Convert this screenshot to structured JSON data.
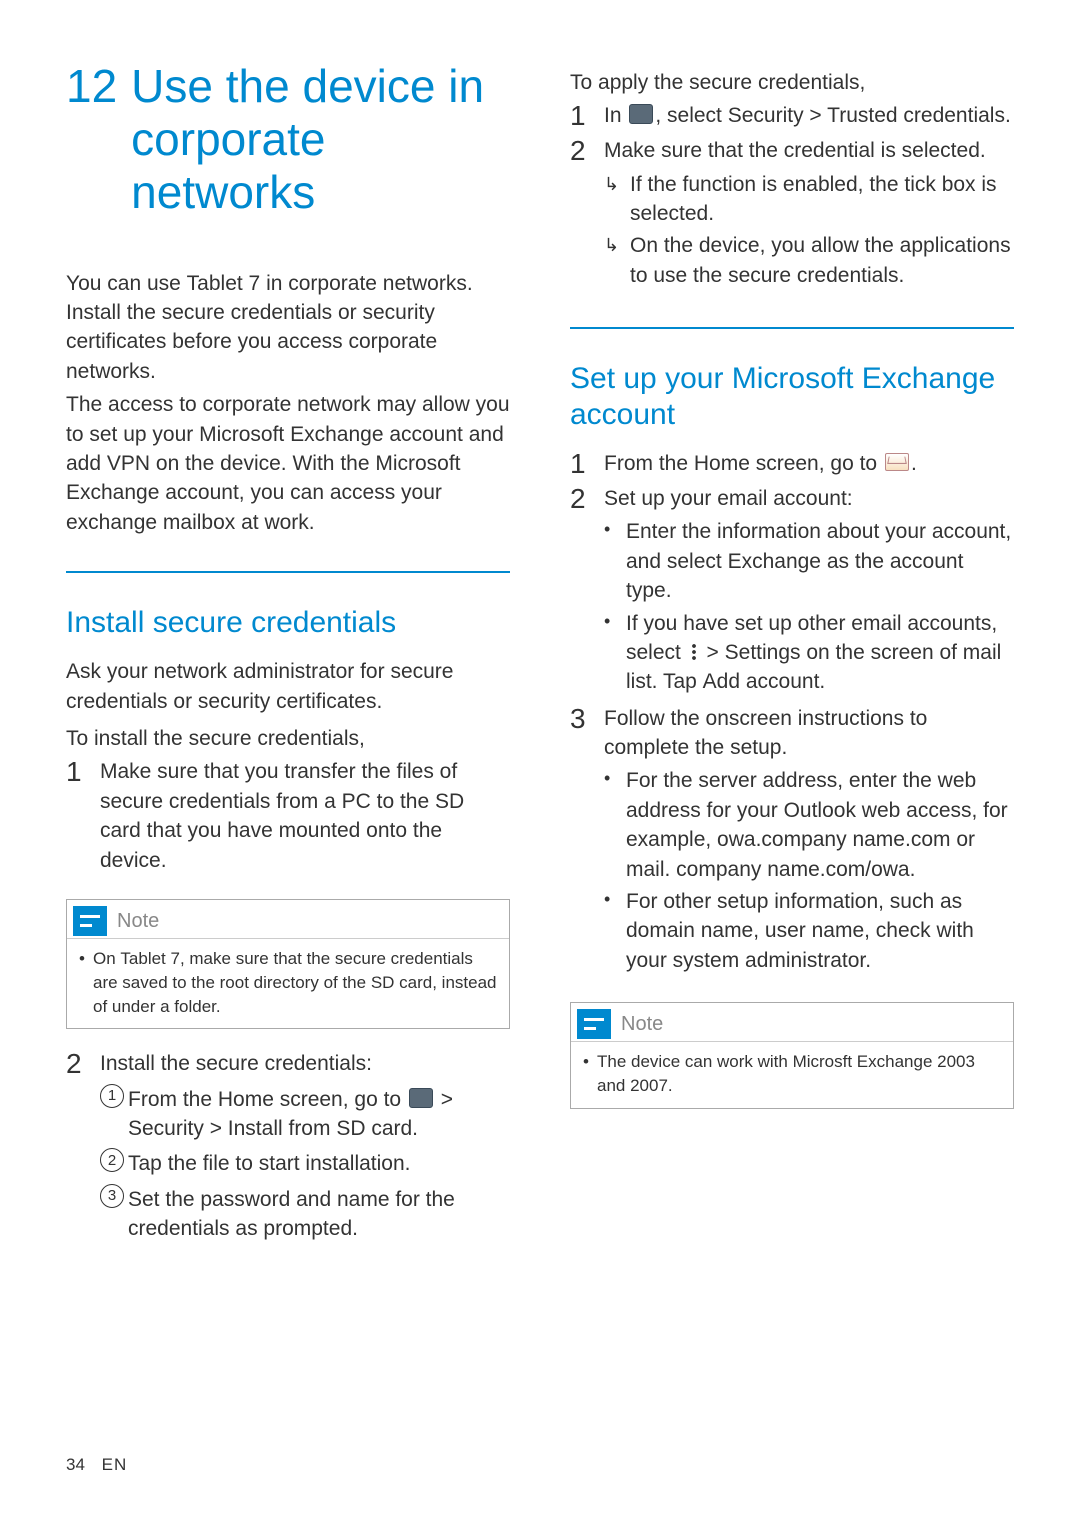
{
  "chapter": {
    "number": "12",
    "title": "Use the device in corporate networks"
  },
  "intro": {
    "p1a": "You can use ",
    "p1b": "Tablet 7",
    "p1c": " in corporate networks. Install the secure credentials or security certificates before you access corporate networks.",
    "p2": "The access to corporate network may allow you to set up your Microsoft Exchange account and add VPN on the device. With the Microsoft Exchange account, you can access your exchange mailbox at work."
  },
  "sectionA": {
    "title": "Install secure credentials",
    "lead": "Ask your network administrator for secure credentials or security certificates.",
    "sub1": "To install the secure credentials,",
    "step1": "Make sure that you transfer the files of secure credentials from a PC to the SD card that you have mounted onto the device.",
    "note_label": "Note",
    "note_a": "On ",
    "note_b": "Tablet 7",
    "note_c": ", make sure that the secure credentials are saved to the root directory of the SD card, instead of under a folder.",
    "step2_intro": "Install the secure credentials:",
    "sub_a1": "From the Home screen, go to ",
    "sub_a2": " > Security > Install from SD card.",
    "sub_b": "Tap the file to start installation.",
    "sub_c": "Set the password and name for the credentials as prompted."
  },
  "sectionB": {
    "sub1": "To apply the secure credentials,",
    "s1a": "In ",
    "s1b": ", select ",
    "s1c": "Security > Trusted credentials",
    "s1d": ".",
    "s2": "Make sure that the credential is selected.",
    "s2_r1": "If the function is enabled, the tick box is selected.",
    "s2_r2": "On the device, you allow the applications to use the secure credentials."
  },
  "sectionC": {
    "title": "Set up your Microsoft Exchange account",
    "s1a": "From the Home screen, go to ",
    "s1b": ".",
    "s2": "Set up your email account:",
    "s2_b1a": "Enter the information about your account, and select ",
    "s2_b1b": "Exchange",
    "s2_b1c": " as the account type.",
    "s2_b2a": "If you have set up other email accounts, select ",
    "s2_b2b": " > ",
    "s2_b2c": "Settings",
    "s2_b2d": " on the screen of mail list. Tap ",
    "s2_b2e": "Add account",
    "s2_b2f": ".",
    "s3": "Follow the onscreen instructions to complete the setup.",
    "s3_b1": "For the server address, enter the web address for your Outlook web access, for example, owa.company name.com or mail. company name.com/owa.",
    "s3_b2": "For other setup information, such as domain name, user name, check with your system administrator.",
    "note_label": "Note",
    "note": "The device can work with Microsft Exchange 2003 and 2007."
  },
  "footer": {
    "page": "34",
    "lang": "EN"
  }
}
